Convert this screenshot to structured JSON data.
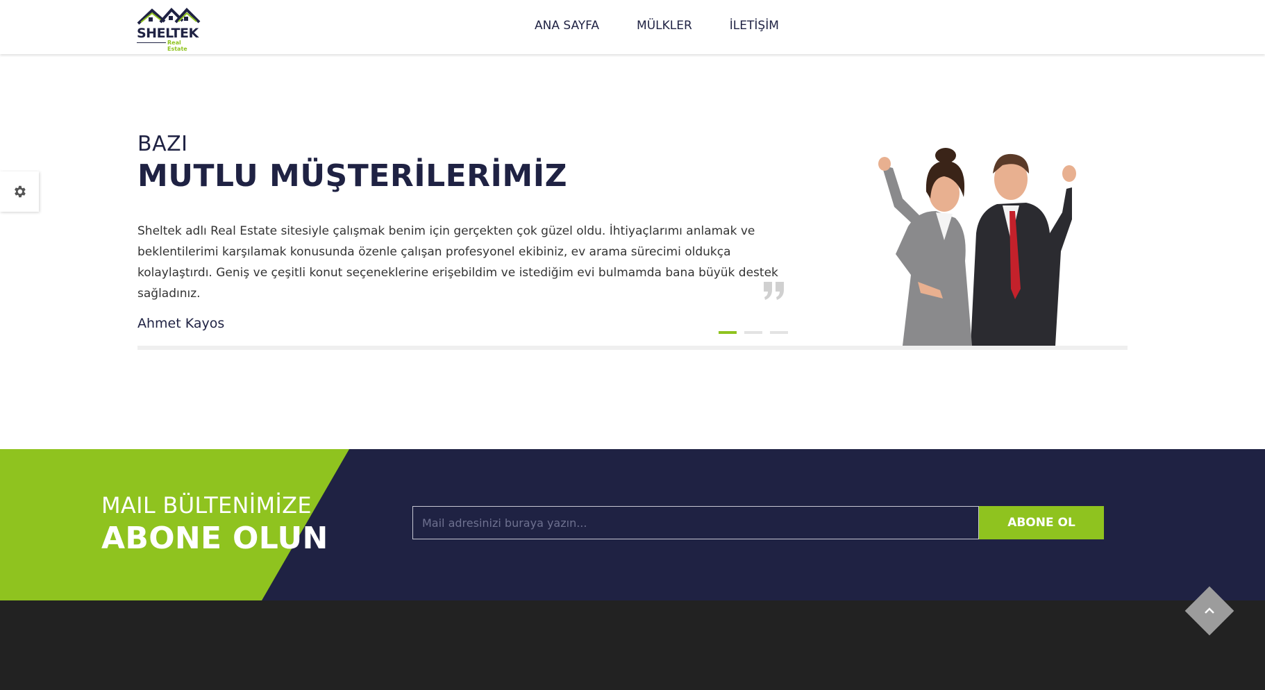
{
  "logo": {
    "word": "SHELTEK",
    "sub": "Real Estate"
  },
  "nav": {
    "items": [
      "ANA SAYFA",
      "MÜLKLER",
      "İLETİŞİM"
    ]
  },
  "testimonial": {
    "kicker": "BAZI",
    "heading": "MUTLU MÜŞTERİLERİMİZ",
    "quote_lines": [
      "Sheltek adlı Real Estate sitesiyle çalışmak benim için gerçekten çok güzel oldu. İhtiyaçlarımı anlamak ve",
      "beklentilerimi karşılamak konusunda özenle çalışan profesyonel ekibiniz, ev arama sürecimi oldukça",
      "kolaylaştırdı. Geniş ve çeşitli konut seçeneklerine erişebildim ve istediğim evi bulmamda bana büyük destek",
      "sağladınız."
    ],
    "author": "Ahmet Kayos",
    "slides": 3,
    "active_slide": 1
  },
  "newsletter": {
    "title_line1": "MAIL BÜLTENİMİZE",
    "title_line2": "ABONE OLUN",
    "input_placeholder": "Mail adresinizi buraya yazın...",
    "button_label": "ABONE OL"
  },
  "colors": {
    "navy": "#1f2243",
    "green": "#8fc31f",
    "footer": "#222222"
  },
  "icons": {
    "settings": "gear-icon",
    "quote": "quote-icon",
    "scroll_top": "chevron-up-icon"
  }
}
